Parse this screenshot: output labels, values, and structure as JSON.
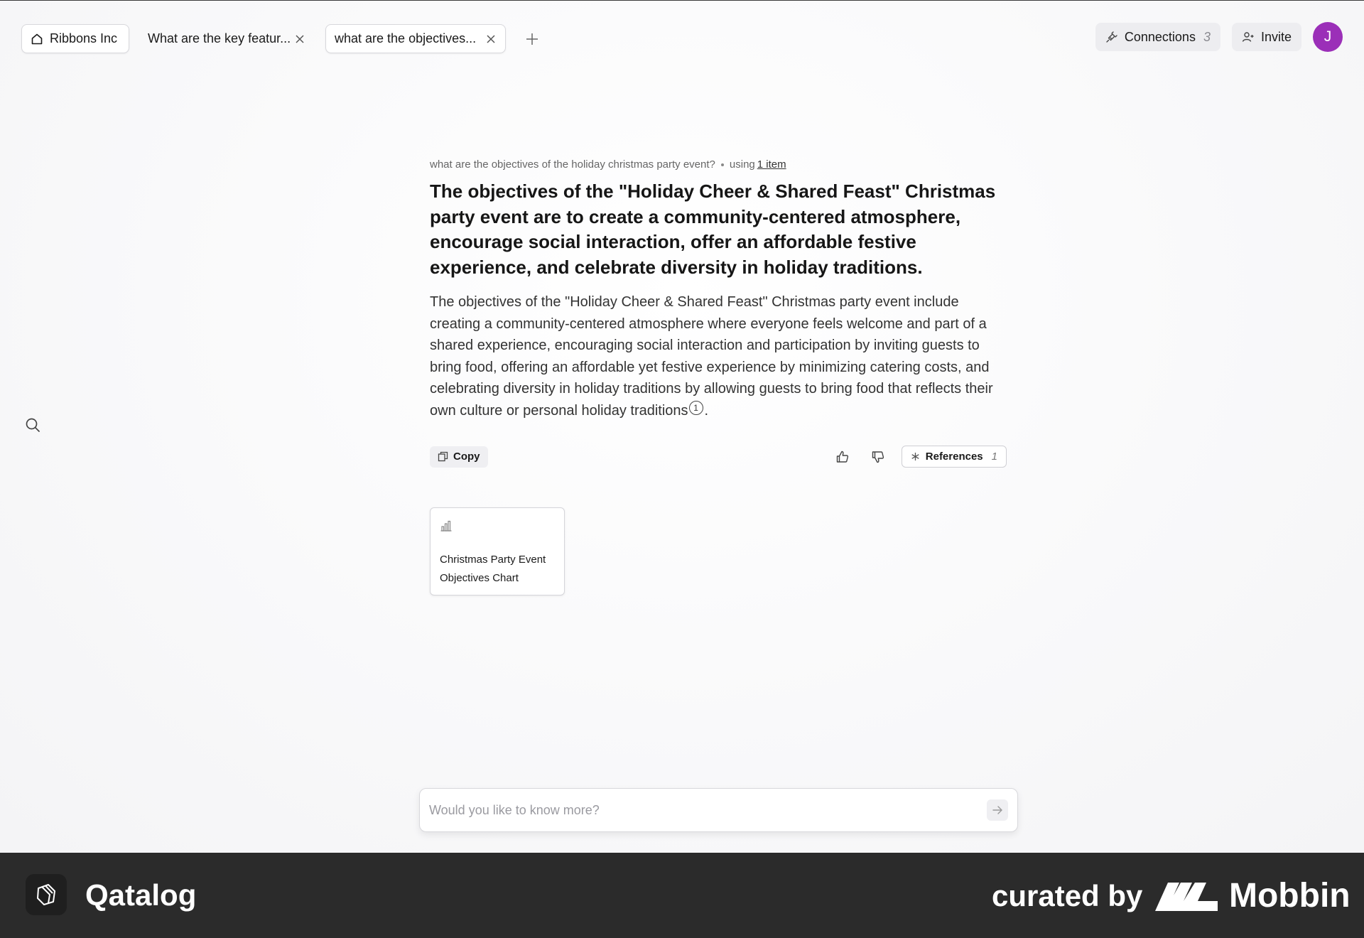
{
  "tabs": {
    "home": {
      "label": "Ribbons Inc"
    },
    "items": [
      {
        "label": "What are the key featur..."
      },
      {
        "label": "what are the objectives..."
      }
    ]
  },
  "header": {
    "connections_label": "Connections",
    "connections_count": "3",
    "invite_label": "Invite",
    "avatar_initial": "J"
  },
  "answer": {
    "query": "what are the objectives of the holiday christmas party event?",
    "using_prefix": "using",
    "using_link": "1 item",
    "headline": "The objectives of the \"Holiday Cheer & Shared Feast\" Christmas party event are to create a community-centered atmosphere, encourage social interaction, offer an affordable festive experience, and celebrate diversity in holiday traditions.",
    "body": "The objectives of the \"Holiday Cheer & Shared Feast\" Christmas party event include creating a community-centered atmosphere where everyone feels welcome and part of a shared experience, encouraging social interaction and participation by inviting guests to bring food, offering an affordable yet festive experience by minimizing catering costs, and celebrating diversity in holiday traditions by allowing guests to bring food that reflects their own culture or personal holiday traditions",
    "citation": "1",
    "body_end": "."
  },
  "actions": {
    "copy_label": "Copy",
    "references_label": "References",
    "references_count": "1"
  },
  "card": {
    "title": "Christmas Party Event Objectives Chart"
  },
  "ask": {
    "placeholder": "Would you like to know more?"
  },
  "footer": {
    "brand": "Qatalog",
    "curated_by": "curated by",
    "partner": "Mobbin"
  },
  "colors": {
    "avatar": "#9b2fb8",
    "footer_bg": "#2b2b2b",
    "page_bg": "#f7f7f8"
  },
  "icons": [
    "home-icon",
    "close-icon",
    "plus-icon",
    "plug-icon",
    "user-plus-icon",
    "search-icon",
    "copy-icon",
    "thumbs-up-icon",
    "thumbs-down-icon",
    "asterisk-icon",
    "bar-chart-icon",
    "arrow-right-icon",
    "qatalog-logo-icon",
    "mobbin-logo-icon"
  ]
}
